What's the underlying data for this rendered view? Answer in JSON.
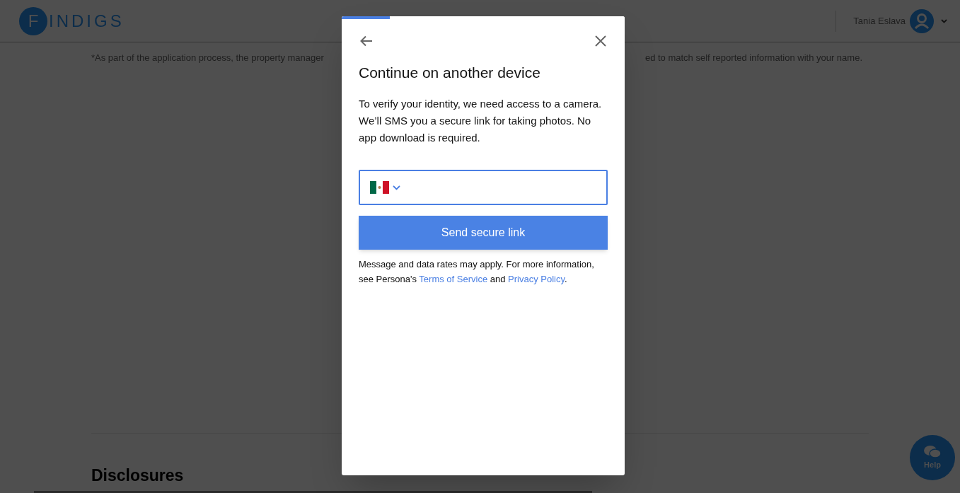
{
  "header": {
    "logo": {
      "initial": "F",
      "rest": "INDIGS"
    },
    "user_name": "Tania Eslava"
  },
  "page": {
    "notice_left": "*As part of the application process, the property manager",
    "notice_right": "ed to match self reported information with your name.",
    "section_title": "Disclosures"
  },
  "modal": {
    "progress": {
      "level": 0.17
    },
    "title": "Continue on another device",
    "description": "To verify your identity, we need access to a camera. We’ll SMS you a secure link for taking photos. No app download is required.",
    "button": "Send secure link",
    "footer_text": "Message and data rates may apply. For more information, see Persona's ",
    "link_1": "Terms of Service",
    "footer_and": " and ",
    "link_2": "Privacy Policy",
    "footer_end": "."
  },
  "help_button": {
    "label": "Help"
  }
}
